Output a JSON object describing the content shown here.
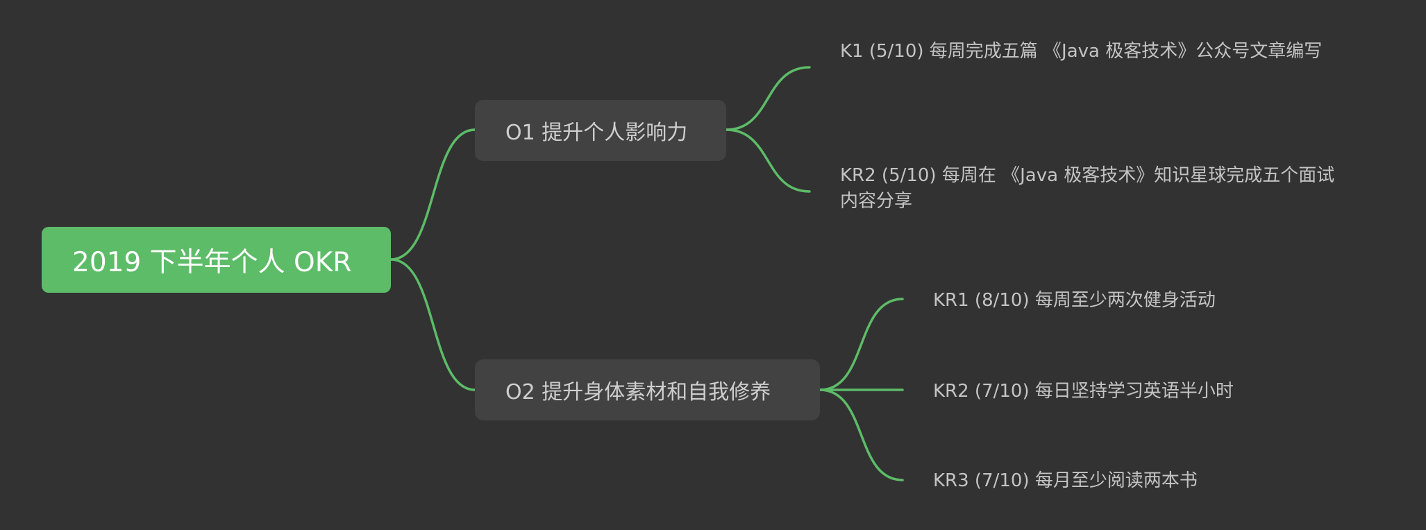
{
  "mindmap": {
    "root": {
      "label": "2019 下半年个人 OKR"
    },
    "objectives": [
      {
        "label": "O1 提升个人影响力",
        "key_results": [
          "K1 (5/10) 每周完成五篇 《Java 极客技术》公众号文章编写",
          "KR2 (5/10) 每周在 《Java 极客技术》知识星球完成五个面试内容分享"
        ]
      },
      {
        "label": "O2 提升身体素材和自我修养",
        "key_results": [
          "KR1 (8/10) 每周至少两次健身活动",
          "KR2 (7/10) 每日坚持学习英语半小时",
          "KR3 (7/10) 每月至少阅读两本书"
        ]
      }
    ]
  },
  "colors": {
    "background": "#323232",
    "root_fill": "#5dbc68",
    "connector": "#5dbc68",
    "objective_fill": "#424242"
  }
}
